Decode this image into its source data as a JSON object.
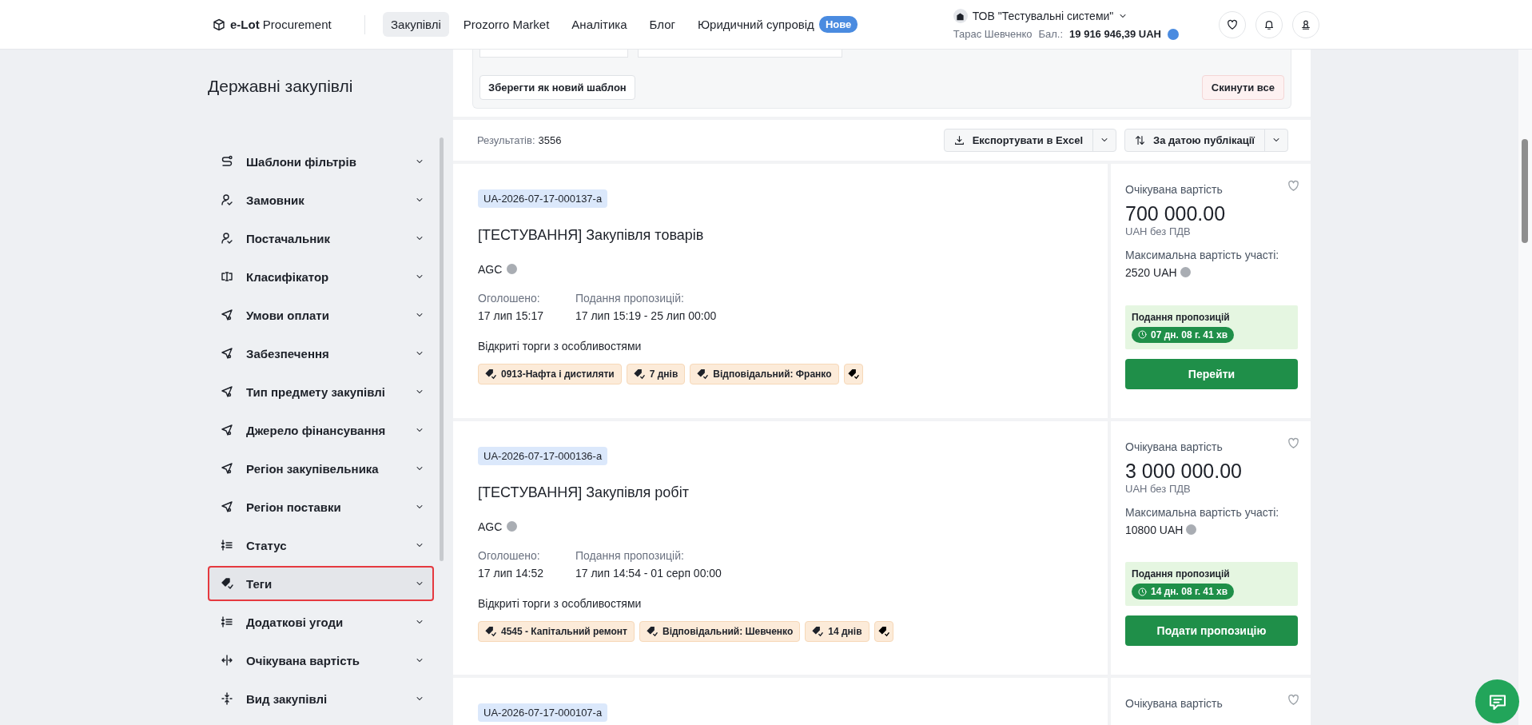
{
  "header": {
    "logo_bold": "e-Lot",
    "logo_rest": "Procurement",
    "nav": [
      {
        "label": "Закупівлі",
        "selected": true
      },
      {
        "label": "Prozorro Market",
        "selected": false
      },
      {
        "label": "Аналітика",
        "selected": false
      },
      {
        "label": "Блог",
        "selected": false
      },
      {
        "label": "Юридичний супровід",
        "selected": false,
        "badge": "Нове"
      }
    ],
    "org": "ТОВ \"Тестувальні системи\"",
    "user": "Тарас Шевченко",
    "balance_label": "Бал.:",
    "balance": "19 916 946,39 UAH"
  },
  "sidebar": {
    "title": "Державні закупівлі",
    "items": [
      {
        "label": "Шаблони фільтрів",
        "kind": "route",
        "selected": false
      },
      {
        "label": "Замовник",
        "kind": "user",
        "selected": false
      },
      {
        "label": "Постачальник",
        "kind": "user",
        "selected": false
      },
      {
        "label": "Класифікатор",
        "kind": "code",
        "selected": false
      },
      {
        "label": "Умови оплати",
        "kind": "send",
        "selected": false
      },
      {
        "label": "Забезпечення",
        "kind": "send",
        "selected": false
      },
      {
        "label": "Тип предмету закупівлі",
        "kind": "send",
        "selected": false
      },
      {
        "label": "Джерело фінансування",
        "kind": "send",
        "selected": false
      },
      {
        "label": "Регіон закупівельника",
        "kind": "send",
        "selected": false
      },
      {
        "label": "Регіон поставки",
        "kind": "send",
        "selected": false
      },
      {
        "label": "Статус",
        "kind": "sort",
        "selected": false
      },
      {
        "label": "Теги",
        "kind": "tag",
        "selected": true
      },
      {
        "label": "Додаткові угоди",
        "kind": "sort",
        "selected": false
      },
      {
        "label": "Очікувана вартість",
        "kind": "range",
        "selected": false
      },
      {
        "label": "Вид закупівлі",
        "kind": "collapse",
        "selected": false
      }
    ]
  },
  "filters": {
    "save_button": "Зберегти як новий шаблон",
    "reset_button": "Скинути все"
  },
  "results": {
    "label": "Результатів:",
    "count": "3556",
    "export_button": "Експортувати в Excel",
    "sort_button": "За датою публікації"
  },
  "tenders": [
    {
      "id": "UA-2026-07-17-000137-a",
      "title": "[ТЕСТУВАННЯ] Закупівля товарів",
      "org": "AGC",
      "announced_label": "Оголошено:",
      "announced": "17 лип 15:17",
      "period_label": "Подання пропозицій:",
      "period": "17 лип 15:19 - 25 лип 00:00",
      "procedure": "Відкриті торги з особливостями",
      "tags": [
        "0913-Нафта і дистиляти",
        "7 днів",
        "Відповідальний: Франко"
      ],
      "value_label": "Очікувана вартість",
      "value": "700 000.00",
      "value_note": "UAH без ПДВ",
      "max_label": "Максимальна вартість участі:",
      "max_value": "2520 UAH",
      "status": "Подання пропозицій",
      "timer": "07 дн. 08 г. 41 хв",
      "action": "Перейти"
    },
    {
      "id": "UA-2026-07-17-000136-a",
      "title": "[ТЕСТУВАННЯ] Закупівля робіт",
      "org": "AGC",
      "announced_label": "Оголошено:",
      "announced": "17 лип 14:52",
      "period_label": "Подання пропозицій:",
      "period": "17 лип 14:54 - 01 серп 00:00",
      "procedure": "Відкриті торги з особливостями",
      "tags": [
        "4545 - Капітальний ремонт",
        "Відповідальний: Шевченко",
        "14 днів"
      ],
      "value_label": "Очікувана вартість",
      "value": "3 000 000.00",
      "value_note": "UAH без ПДВ",
      "max_label": "Максимальна вартість участі:",
      "max_value": "10800 UAH",
      "status": "Подання пропозицій",
      "timer": "14 дн. 08 г. 41 хв",
      "action": "Подати пропозицію"
    },
    {
      "id": "UA-2026-07-17-000107-a",
      "value_label": "Очікувана вартість"
    }
  ]
}
